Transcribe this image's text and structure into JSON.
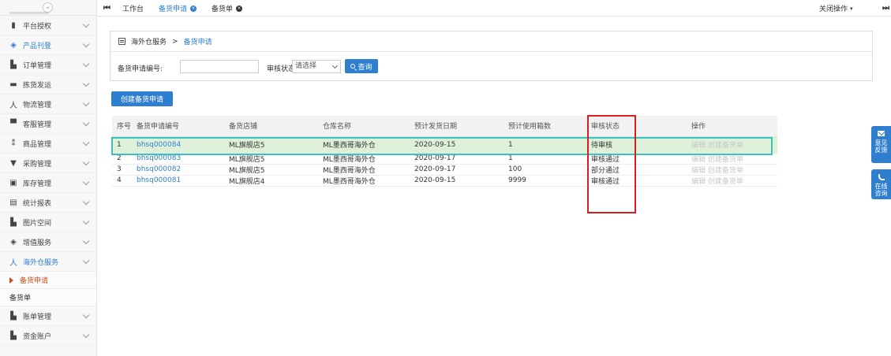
{
  "sidebar": {
    "collapse_icon": "chevron-left-circle-icon",
    "cut_off_label": "",
    "items": [
      {
        "label": "平台授权",
        "icon": "bookmark-icon"
      },
      {
        "label": "产品刊登",
        "icon": "cube-icon",
        "active": true
      },
      {
        "label": "订单管理",
        "icon": "file-icon"
      },
      {
        "label": "拣货发运",
        "icon": "truck-icon"
      },
      {
        "label": "物流管理",
        "icon": "person-icon"
      },
      {
        "label": "客服管理",
        "icon": "headset-icon"
      },
      {
        "label": "商品管理",
        "icon": "tags-icon"
      },
      {
        "label": "采购管理",
        "icon": "cart-icon"
      },
      {
        "label": "库存管理",
        "icon": "box-icon"
      },
      {
        "label": "统计报表",
        "icon": "table-icon"
      },
      {
        "label": "图片空间",
        "icon": "file-icon"
      },
      {
        "label": "增值服务",
        "icon": "cube-icon"
      },
      {
        "label": "海外仓服务",
        "icon": "person-icon",
        "active": true
      }
    ],
    "sub_items": [
      {
        "label": "备货申请",
        "current": true
      },
      {
        "label": "备货单"
      }
    ],
    "items_after": [
      {
        "label": "账单管理",
        "icon": "file-icon"
      },
      {
        "label": "资金账户",
        "icon": "file-icon"
      }
    ]
  },
  "tabbar": {
    "prev_icon": "skip-back-icon",
    "next_icon": "skip-forward-icon",
    "tabs": [
      {
        "label": "工作台"
      },
      {
        "label": "备货申请",
        "active": true
      },
      {
        "label": "备货单"
      }
    ],
    "close_ops_label": "关闭操作",
    "close_ops_arrow": "▾"
  },
  "breadcrumb": {
    "parent": "海外仓服务",
    "separator": ">",
    "current": "备货申请"
  },
  "filters": {
    "code_label": "备货申请编号:",
    "code_value": "",
    "status_label": "审核状态:",
    "status_value": "请选择",
    "search_button": "查询"
  },
  "create_button": "创建备货申请",
  "table": {
    "headers": [
      "序号",
      "备货申请编号",
      "备货店铺",
      "仓库名称",
      "预计发货日期",
      "预计使用箱数",
      "审核状态",
      "操作"
    ],
    "rows": [
      {
        "idx": "1",
        "code": "bhsq000084",
        "shop": "ML旗舰店5",
        "warehouse": "ML墨西哥海外仓",
        "date": "2020-09-15",
        "boxes": "1",
        "status": "待审核",
        "ops": "编辑 创建备货单"
      },
      {
        "idx": "2",
        "code": "bhsq000083",
        "shop": "ML旗舰店5",
        "warehouse": "ML墨西哥海外仓",
        "date": "2020-09-17",
        "boxes": "1",
        "status": "审核通过",
        "ops": "编辑 创建备货单"
      },
      {
        "idx": "3",
        "code": "bhsq000082",
        "shop": "ML旗舰店5",
        "warehouse": "ML墨西哥海外仓",
        "date": "2020-09-17",
        "boxes": "100",
        "status": "部分通过",
        "ops": "编辑 创建备货单"
      },
      {
        "idx": "4",
        "code": "bhsq000081",
        "shop": "ML旗舰店4",
        "warehouse": "ML墨西哥海外仓",
        "date": "2020-09-15",
        "boxes": "9999",
        "status": "审核通过",
        "ops": "编辑 创建备货单"
      }
    ]
  },
  "float_buttons": {
    "feedback": [
      "意见",
      "反馈"
    ],
    "consult": [
      "在线",
      "咨询"
    ]
  },
  "colors": {
    "accent": "#2f7fd1",
    "highlight_row": "#dff0d8",
    "row_outline": "#38c4bd",
    "status_outline": "#d62020",
    "current_sub": "#c7501f"
  }
}
